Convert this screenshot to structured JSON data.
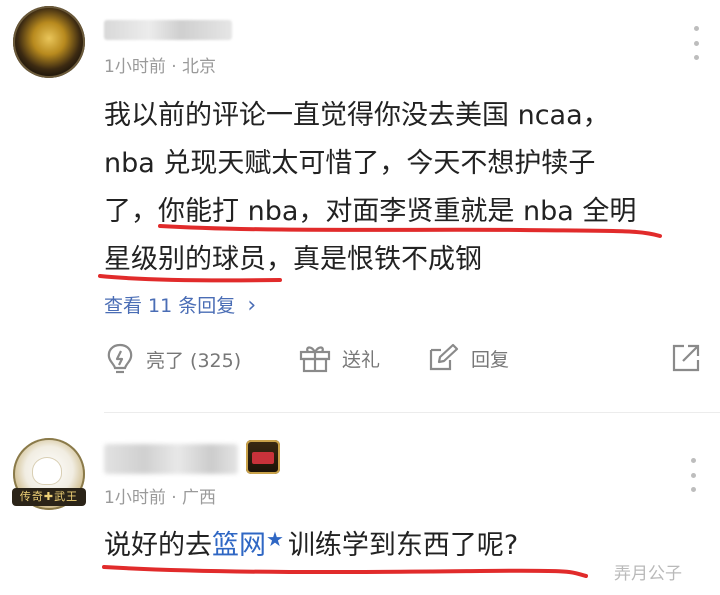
{
  "comment1": {
    "meta": {
      "time": "1小时前",
      "separator": " · ",
      "location": "北京"
    },
    "body_lines": [
      "我以前的评论一直觉得你没去美国 ncaa，",
      "nba 兑现天赋太可惜了，今天不想护犊子",
      "了，你能打 nba，对面李贤重就是 nba 全明",
      "星级别的球员，真是恨铁不成钢"
    ],
    "view_replies": "查看 11 条回复",
    "view_replies_arrow": "›",
    "actions": {
      "like": "亮了 (325)",
      "gift": "送礼",
      "reply": "回复"
    }
  },
  "comment2": {
    "meta": {
      "time": "1小时前",
      "separator": " · ",
      "location": "广西"
    },
    "avatar_badge": "传奇✚武王",
    "body_before": "说好的去",
    "body_link": "篮网",
    "body_after": "训练学到东西了呢?"
  },
  "watermark": "弄月公子",
  "colors": {
    "text": "#222222",
    "meta": "#9a9a9a",
    "link": "#4a6db5",
    "underline": "#e12b2b"
  },
  "icons": [
    "more-vertical-icon",
    "lightbulb-icon",
    "gift-icon",
    "edit-icon",
    "share-icon",
    "star-icon"
  ]
}
